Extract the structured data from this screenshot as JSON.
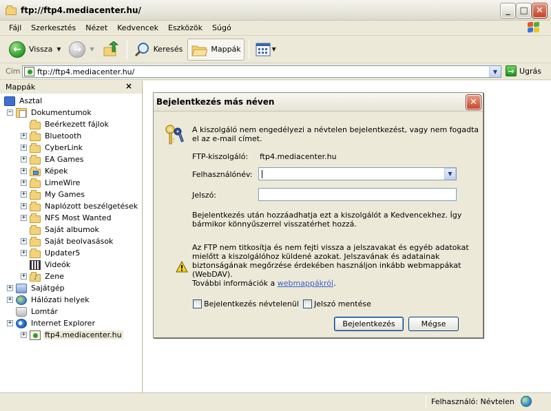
{
  "window": {
    "title": "ftp://ftp4.mediacenter.hu/"
  },
  "menubar": {
    "items": [
      "Fájl",
      "Szerkesztés",
      "Nézet",
      "Kedvencek",
      "Eszközök",
      "Súgó"
    ]
  },
  "toolbar": {
    "back_label": "Vissza",
    "search_label": "Keresés",
    "folders_label": "Mappák"
  },
  "address": {
    "label": "Cím",
    "value": "ftp://ftp4.mediacenter.hu/",
    "go_label": "Ugrás"
  },
  "folders_pane": {
    "title": "Mappák",
    "close": "×",
    "items": [
      {
        "label": "Asztal",
        "icon": "desktop-icon"
      },
      {
        "label": "Dokumentumok",
        "icon": "documents-icon",
        "expander": "−"
      },
      {
        "label": "Beérkezett fájlok",
        "icon": "folder-icon"
      },
      {
        "label": "Bluetooth",
        "icon": "folder-icon",
        "expander": "+"
      },
      {
        "label": "CyberLink",
        "icon": "folder-icon",
        "expander": "+"
      },
      {
        "label": "EA Games",
        "icon": "folder-icon",
        "expander": "+"
      },
      {
        "label": "Képek",
        "icon": "pictures-folder-icon",
        "expander": "+"
      },
      {
        "label": "LimeWire",
        "icon": "folder-icon",
        "expander": "+"
      },
      {
        "label": "My Games",
        "icon": "folder-icon",
        "expander": "+"
      },
      {
        "label": "Naplózott beszélgetések",
        "icon": "folder-icon",
        "expander": "+"
      },
      {
        "label": "NFS Most Wanted",
        "icon": "folder-icon",
        "expander": "+"
      },
      {
        "label": "Saját albumok",
        "icon": "folder-icon"
      },
      {
        "label": "Saját beolvasások",
        "icon": "folder-icon",
        "expander": "+"
      },
      {
        "label": "Updater5",
        "icon": "folder-icon",
        "expander": "+"
      },
      {
        "label": "Videók",
        "icon": "video-folder-icon"
      },
      {
        "label": "Zene",
        "icon": "music-folder-icon",
        "expander": "+"
      },
      {
        "label": "Sajátgép",
        "icon": "computer-icon",
        "expander": "+"
      },
      {
        "label": "Hálózati helyek",
        "icon": "network-icon",
        "expander": "+"
      },
      {
        "label": "Lomtár",
        "icon": "recycle-bin-icon"
      },
      {
        "label": "Internet Explorer",
        "icon": "internet-explorer-icon",
        "expander": "+"
      },
      {
        "label": "ftp4.mediacenter.hu",
        "icon": "ftp-site-icon",
        "expander": "+"
      }
    ]
  },
  "dialog": {
    "title": "Bejelentkezés más néven",
    "close": "✕",
    "intro": "A kiszolgáló nem engedélyezi a névtelen bejelentkezést, vagy nem fogadta el az e-mail címet.",
    "server_label": "FTP-kiszolgáló:",
    "server_value": "ftp4.mediacenter.hu",
    "username_label": "Felhasználónév:",
    "username_value": "",
    "password_label": "Jelszó:",
    "password_value": "",
    "favorites_note": "Bejelentkezés után hozzáadhatja ezt a kiszolgálót a Kedvencekhez. Így bármikor könnyűszerrel visszatérhet hozzá.",
    "warning_text": "Az FTP nem titkosítja és nem fejti vissza a jelszavakat és egyéb adatokat mielőtt a kiszolgálóhoz küldené azokat. Jelszavának és adatainak biztonságának megőrzése érdekében használjon inkább webmappákat (WebDAV).",
    "more_info_prefix": "További információk a ",
    "more_info_link": "webmappákról",
    "more_info_suffix": ".",
    "anonymous_label": "Bejelentkezés névtelenül",
    "save_password_label": "Jelszó mentése",
    "login_button": "Bejelentkezés",
    "cancel_button": "Mégse"
  },
  "statusbar": {
    "user": "Felhasználó: Névtelen"
  },
  "colors": {
    "window_bg": "#ece9d8",
    "link": "#3a5fcd",
    "dialog_close": "#c8472c"
  }
}
